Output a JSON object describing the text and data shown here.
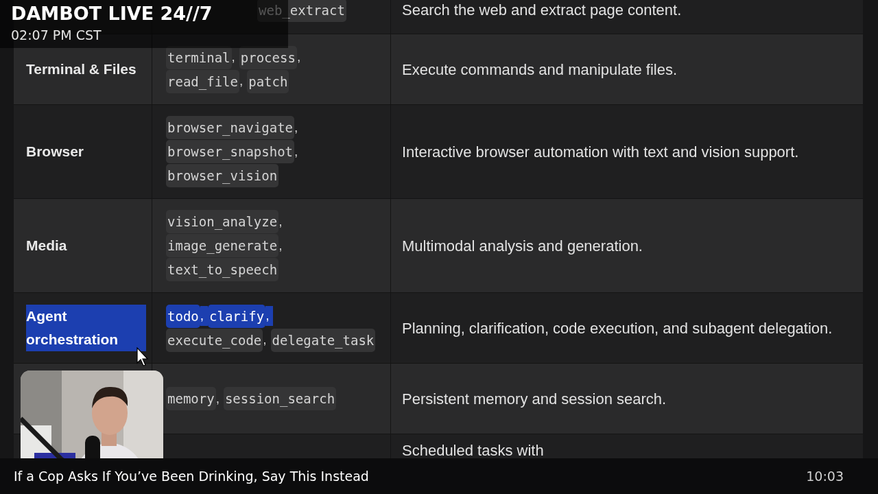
{
  "table": {
    "rows": [
      {
        "tool_lines": [
          [
            {
              "covered": true
            },
            {
              "name": "web_extract",
              "highlighted": false
            }
          ]
        ],
        "description": "Search the web and extract page content."
      },
      {
        "category": "Terminal & Files",
        "highlighted": false,
        "tool_lines": [
          [
            {
              "name": "terminal",
              "separator": ",",
              "highlighted": false
            },
            {
              "name": "process",
              "separator": ",",
              "highlighted": false
            }
          ],
          [
            {
              "name": "read_file",
              "separator": ",",
              "highlighted": false
            },
            {
              "name": "patch",
              "highlighted": false
            }
          ]
        ],
        "description": "Execute commands and manipulate files."
      },
      {
        "category": "Browser",
        "highlighted": false,
        "tool_lines": [
          [
            {
              "name": "browser_navigate",
              "separator": ",",
              "highlighted": false
            }
          ],
          [
            {
              "name": "browser_snapshot",
              "separator": ",",
              "highlighted": false
            }
          ],
          [
            {
              "name": "browser_vision",
              "highlighted": false
            }
          ]
        ],
        "description": "Interactive browser automation with text and vision support."
      },
      {
        "category": "Media",
        "highlighted": false,
        "tool_lines": [
          [
            {
              "name": "vision_analyze",
              "separator": ",",
              "highlighted": false
            }
          ],
          [
            {
              "name": "image_generate",
              "separator": ",",
              "highlighted": false
            }
          ],
          [
            {
              "name": "text_to_speech",
              "highlighted": false
            }
          ]
        ],
        "description": "Multimodal analysis and generation."
      },
      {
        "category": "Agent orchestration",
        "highlighted": true,
        "tool_lines": [
          [
            {
              "name": "todo",
              "separator": ",",
              "highlighted": true
            },
            {
              "name": "clarify",
              "separator": ",",
              "highlighted": true
            }
          ],
          [
            {
              "name": "execute_code",
              "separator": ",",
              "highlighted": false
            },
            {
              "name": "delegate_task",
              "highlighted": false
            }
          ]
        ],
        "description": "Planning, clarification, code execution, and subagent delegation."
      },
      {
        "tool_lines": [
          [
            {
              "name": "memory",
              "separator": ",",
              "highlighted": false
            },
            {
              "name": "session_search",
              "highlighted": false
            }
          ]
        ],
        "description": "Persistent memory and session search."
      },
      {
        "tool_lines": [],
        "description": "Scheduled tasks with"
      }
    ]
  },
  "overlay": {
    "title": "DAMBOT LIVE 24//7",
    "time": "02:07 PM CST"
  },
  "caption": {
    "title": "If a Cop Asks If You’ve Been Drinking, Say This Instead",
    "duration": "10:03"
  }
}
